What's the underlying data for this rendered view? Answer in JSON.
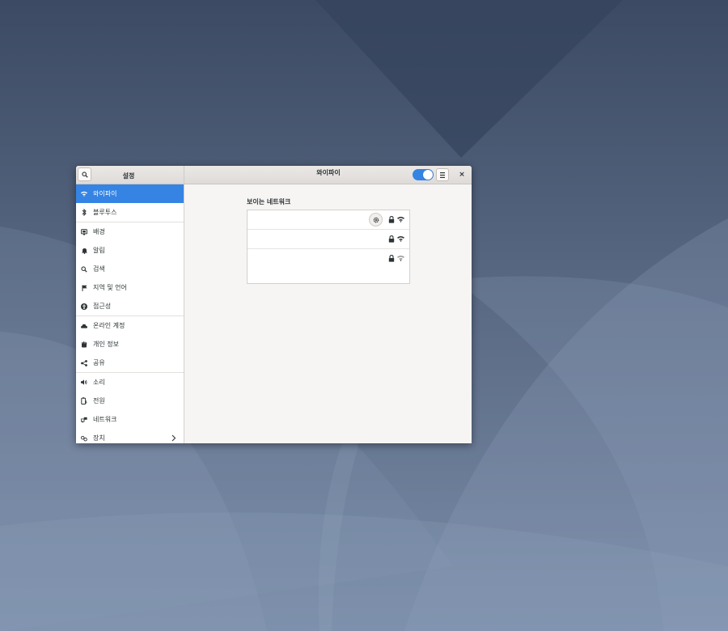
{
  "window": {
    "sidebar_title": "설정",
    "main_title": "와이파이",
    "wifi_enabled": true,
    "close_label": "×"
  },
  "sidebar": {
    "items": [
      {
        "label": "와이파이",
        "icon": "wifi-icon",
        "selected": true
      },
      {
        "label": "블루투스",
        "icon": "bluetooth-icon"
      },
      {
        "label": "배경",
        "icon": "background-icon"
      },
      {
        "label": "알림",
        "icon": "bell-icon"
      },
      {
        "label": "검색",
        "icon": "search-icon"
      },
      {
        "label": "지역 및 언어",
        "icon": "flag-icon"
      },
      {
        "label": "접근성",
        "icon": "accessibility-icon"
      },
      {
        "label": "온라인 계정",
        "icon": "cloud-icon"
      },
      {
        "label": "개인 정보",
        "icon": "hand-icon"
      },
      {
        "label": "공유",
        "icon": "share-icon"
      },
      {
        "label": "소리",
        "icon": "speaker-icon"
      },
      {
        "label": "전원",
        "icon": "battery-icon"
      },
      {
        "label": "네트워크",
        "icon": "network-icon"
      },
      {
        "label": "장치",
        "icon": "devices-icon",
        "has_submenu": true
      }
    ]
  },
  "content": {
    "section_title": "보이는 네트워크",
    "networks": [
      {
        "name": "",
        "connected": true,
        "secured": true,
        "signal": "strong"
      },
      {
        "name": "",
        "connected": false,
        "secured": true,
        "signal": "strong"
      },
      {
        "name": "",
        "connected": false,
        "secured": true,
        "signal": "weak"
      }
    ]
  },
  "colors": {
    "accent": "#3584e4",
    "wallpaper": "#4a5a76"
  }
}
